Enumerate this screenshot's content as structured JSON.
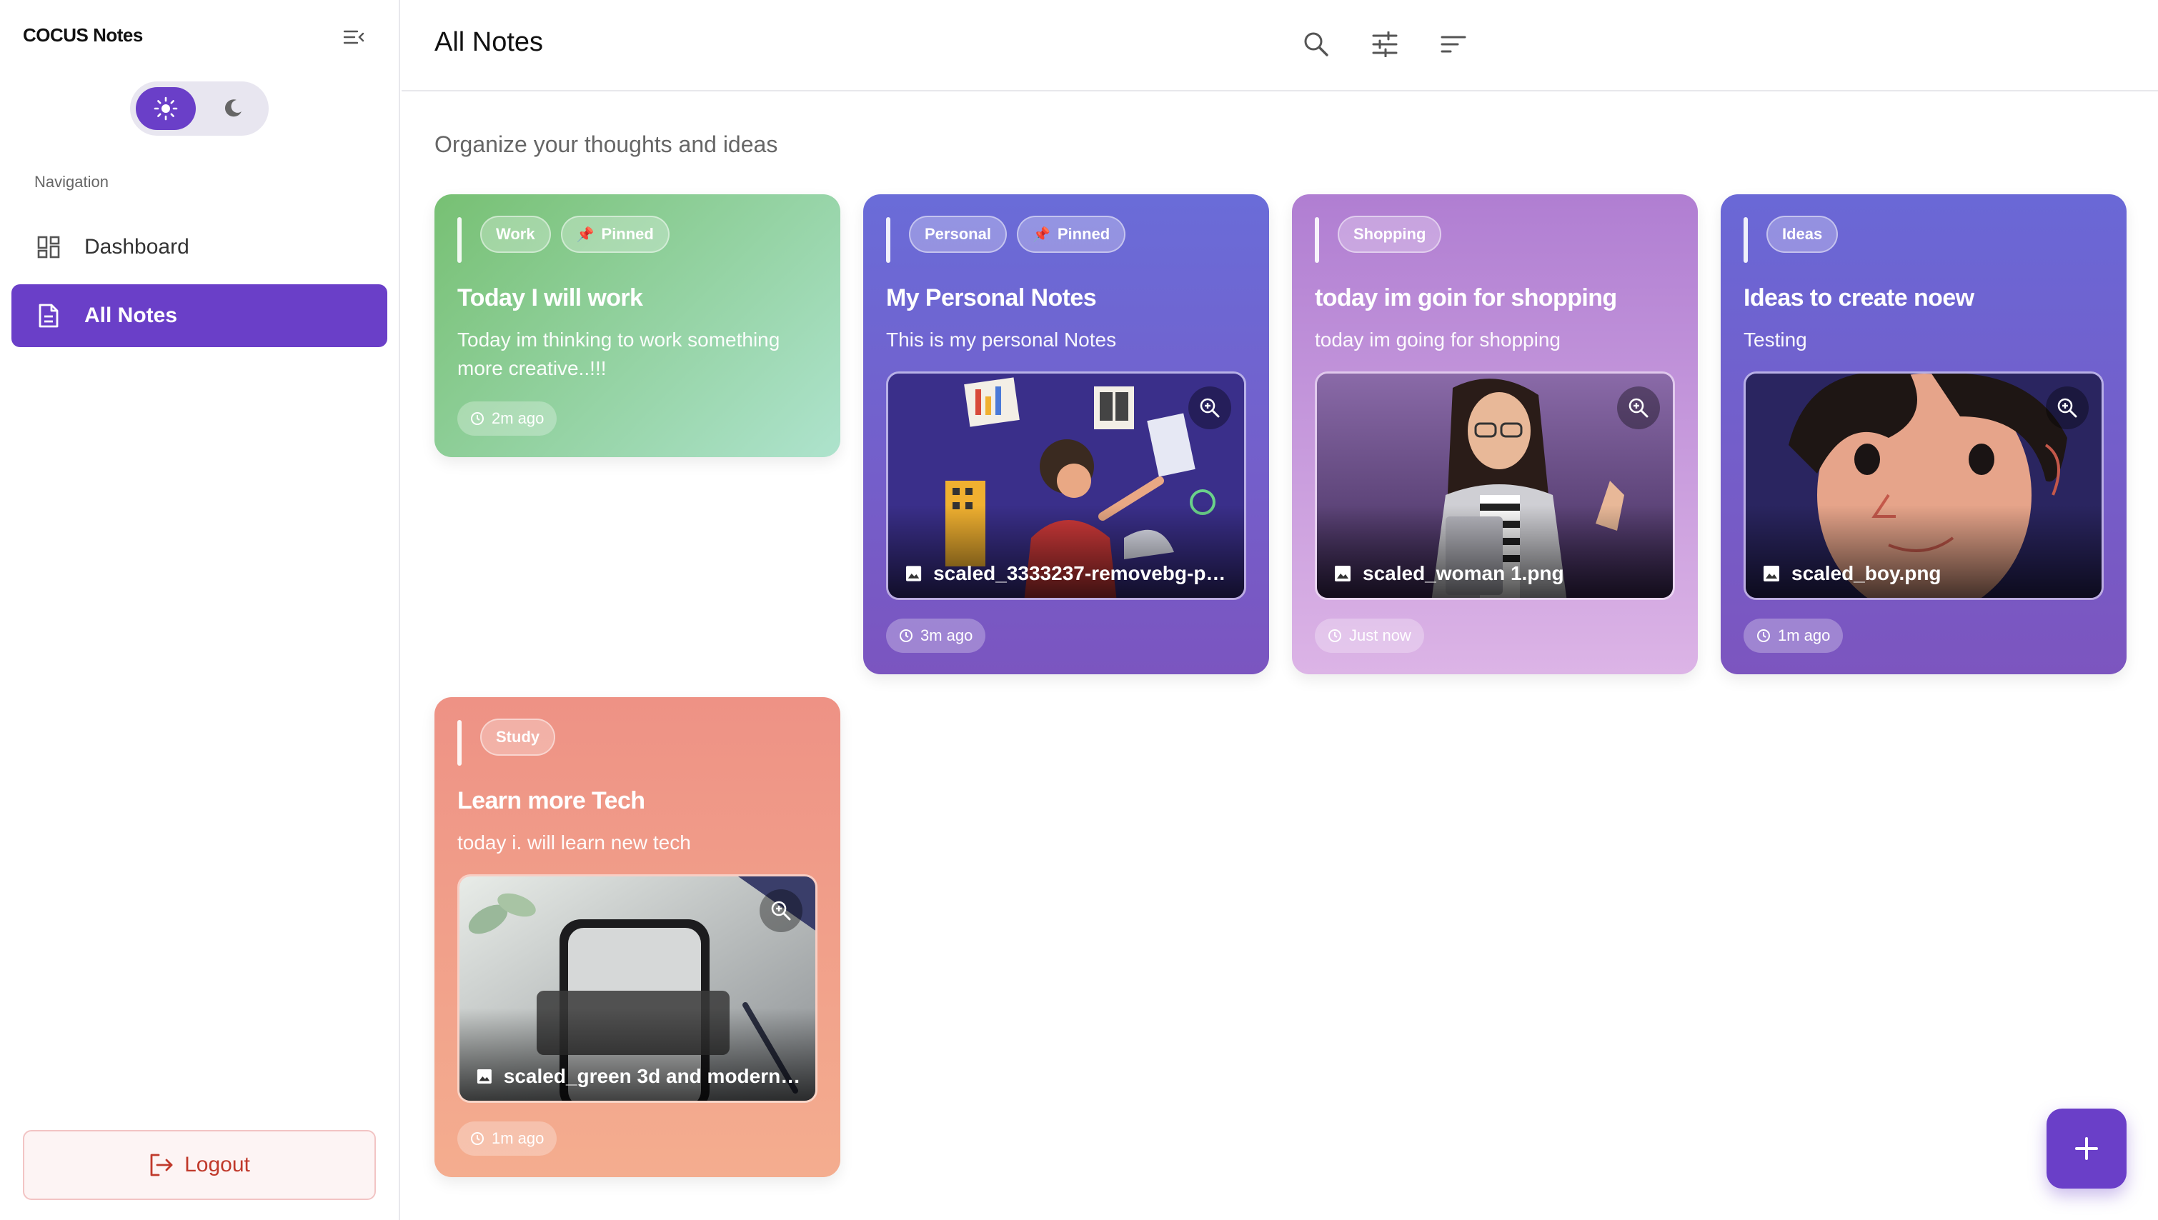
{
  "app": {
    "title": "COCUS Notes"
  },
  "sidebar": {
    "nav_heading": "Navigation",
    "items": [
      {
        "label": "Dashboard",
        "icon": "dashboard-icon",
        "active": false
      },
      {
        "label": "All Notes",
        "icon": "note-icon",
        "active": true
      }
    ],
    "logout_label": "Logout",
    "theme": {
      "selected": "light"
    }
  },
  "header": {
    "title": "All Notes"
  },
  "main": {
    "subtitle": "Organize your thoughts and ideas"
  },
  "notes": [
    {
      "tags": [
        "Work",
        "Pinned"
      ],
      "title": "Today I will work",
      "body": "Today im thinking to work something more creative..!!!",
      "time": "2m ago",
      "image": null,
      "gradient": [
        "#7cc27a",
        "#a8e0c4"
      ]
    },
    {
      "tags": [
        "Personal",
        "Pinned"
      ],
      "title": "My Personal Notes",
      "body": "This is my personal Notes",
      "time": "3m ago",
      "image": "scaled_3333237-removebg-pre...",
      "gradient": [
        "#6d6bd8",
        "#7a56c0"
      ]
    },
    {
      "tags": [
        "Shopping"
      ],
      "title": "today im goin for shopping",
      "body": "today im going for shopping",
      "time": "Just now",
      "image": "scaled_woman 1.png",
      "gradient": [
        "#b27fd2",
        "#dbb0e4"
      ]
    },
    {
      "tags": [
        "Ideas"
      ],
      "title": "Ideas to create noew",
      "body": "Testing",
      "time": "1m ago",
      "image": "scaled_boy.png",
      "gradient": [
        "#6a68d6",
        "#7c55bf"
      ]
    },
    {
      "tags": [
        "Study"
      ],
      "title": "Learn more Tech",
      "body": "today i. will learn new tech",
      "time": "1m ago",
      "image": "scaled_green 3d and modern loc...",
      "gradient": [
        "#ef9385",
        "#f4ac8e"
      ]
    }
  ],
  "fab": {
    "icon": "plus-icon"
  },
  "colors": {
    "accent": "#6a3fc8",
    "logout": "#c0392b"
  }
}
